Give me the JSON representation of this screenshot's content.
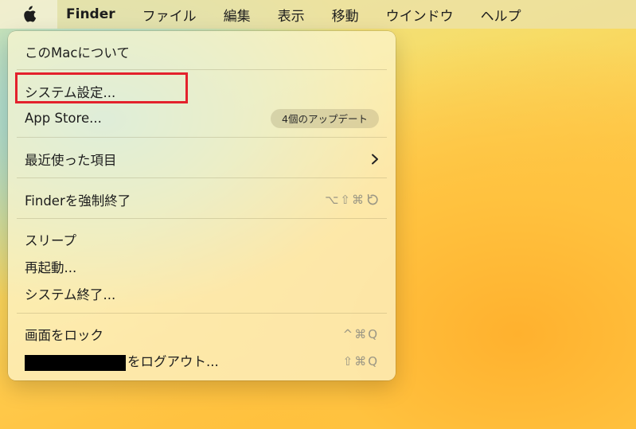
{
  "menubar": {
    "apple_icon": "apple-logo-icon",
    "app_name": "Finder",
    "items": [
      "ファイル",
      "編集",
      "表示",
      "移動",
      "ウインドウ",
      "ヘルプ"
    ]
  },
  "apple_menu": {
    "about": "このMacについて",
    "system_settings": "システム設定...",
    "app_store": "App Store...",
    "app_store_badge": "4個のアップデート",
    "recent_items": "最近使った項目",
    "force_quit": "Finderを強制終了",
    "force_quit_shortcut": "⌥⇧⌘",
    "sleep": "スリープ",
    "restart": "再起動...",
    "shutdown": "システム終了...",
    "lock_screen": "画面をロック",
    "lock_screen_shortcut": "^⌘Q",
    "logout": "をログアウト...",
    "logout_shortcut": "⇧⌘Q"
  },
  "colors": {
    "highlight_border": "#e3212c"
  }
}
